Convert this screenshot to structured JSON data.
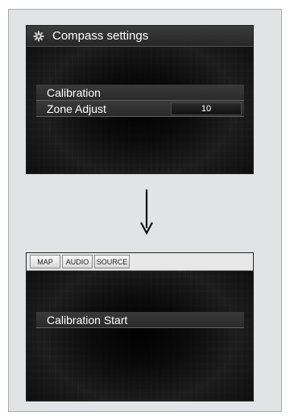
{
  "screen1": {
    "title": "Compass settings",
    "title_icon": "gear-icon",
    "menu": {
      "calibration_label": "Calibration",
      "zone_adjust_label": "Zone Adjust",
      "zone_adjust_value": "10"
    }
  },
  "arrow": {
    "icon": "down-arrow-icon"
  },
  "screen2": {
    "tabs": [
      "MAP",
      "AUDIO",
      "SOURCE"
    ],
    "calibration_start_label": "Calibration Start"
  },
  "colors": {
    "screen_bg": "#0d0d0d",
    "menu_text": "#ffffff",
    "panel_bg": "#e2e3e5"
  }
}
